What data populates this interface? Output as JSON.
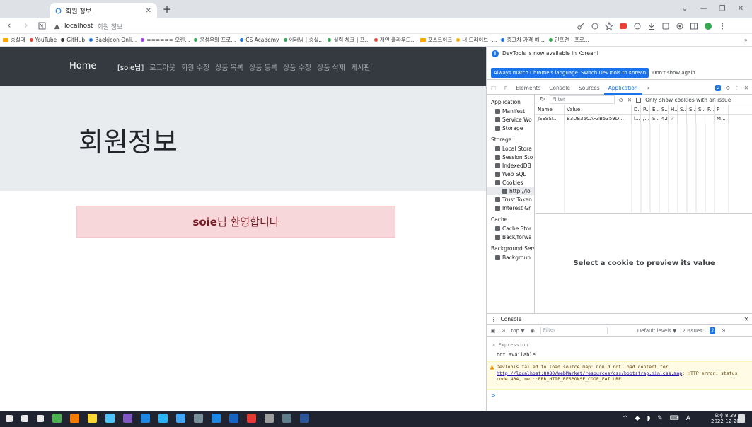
{
  "browser": {
    "tab_title": "회원 정보",
    "address_host": "localhost",
    "address_path": "회원 정보",
    "bookmarks": [
      {
        "label": "숭실대",
        "color": "#f9ab00",
        "folder": true
      },
      {
        "label": "YouTube",
        "color": "#ea4335"
      },
      {
        "label": "GitHub",
        "color": "#333333"
      },
      {
        "label": "Baekjoon Onli...",
        "color": "#1a73e8"
      },
      {
        "label": "====== 오렌...",
        "color": "#a142f4"
      },
      {
        "label": "윤성우의 프로...",
        "color": "#34a853"
      },
      {
        "label": "CS Academy",
        "color": "#1a73e8"
      },
      {
        "label": "이러닝 | 숭실...",
        "color": "#34a853"
      },
      {
        "label": "실력 체크 | 프...",
        "color": "#34a853"
      },
      {
        "label": "개인 클라우드...",
        "color": "#ea4335"
      },
      {
        "label": "포스트이크",
        "color": "#f9ab00",
        "folder": true
      },
      {
        "label": "내 드라이브 -...",
        "color": "#f9ab00"
      },
      {
        "label": "중고차 가격 예...",
        "color": "#1a73e8"
      },
      {
        "label": "인프런 - 프로...",
        "color": "#34a853"
      }
    ]
  },
  "page": {
    "nav_home": "Home",
    "nav_links": [
      "[soie님]",
      "로그아웃",
      "회원 수정",
      "상품 목록",
      "상품 등록",
      "상품 수정",
      "상품 삭제",
      "게시판"
    ],
    "jumbotron_title": "회원정보",
    "welcome_name": "soie",
    "welcome_suffix": "님 환영합니다"
  },
  "devtools": {
    "info_text": "DevTools is now available in Korean!",
    "btn_match": "Always match Chrome's language",
    "btn_switch": "Switch DevTools to Korean",
    "btn_dont_show": "Don't show again",
    "tabs": [
      "Elements",
      "Console",
      "Sources",
      "Application"
    ],
    "active_tab": "Application",
    "more_tabs": "»",
    "issues_count": "2",
    "sidebar": {
      "application_head": "Application",
      "application_items": [
        "Manifest",
        "Service Wo",
        "Storage"
      ],
      "storage_head": "Storage",
      "storage_items": [
        "Local Stora",
        "Session Sto",
        "IndexedDB",
        "Web SQL",
        "Cookies"
      ],
      "cookie_sub": "http://lo",
      "storage_items_2": [
        "Trust Token",
        "Interest Gr"
      ],
      "cache_head": "Cache",
      "cache_items": [
        "Cache Stor",
        "Back/forwa"
      ],
      "bg_head": "Background Servi",
      "bg_items": [
        "Backgroun"
      ]
    },
    "filter_placeholder": "Filter",
    "only_issue_label": "Only show cookies with an issue",
    "cookie_columns": [
      "Name",
      "Value",
      "D...",
      "P...",
      "E...",
      "S...",
      "H...",
      "S...",
      "S...",
      "S...",
      "P...",
      "P"
    ],
    "cookie_row": [
      "JSESSI...",
      "B3DE35CAF3B5359D...",
      "l...",
      "/...",
      "S...",
      "42",
      "✓",
      "",
      "",
      "",
      "",
      "M..."
    ],
    "preview_text": "Select a cookie to preview its value",
    "console_title": "Console",
    "console_context": "top ▼",
    "console_filter": "Filter",
    "default_levels": "Default levels ▼",
    "issues_label": "2 Issues:",
    "issues_badge": "2",
    "expression_label": "Expression",
    "expression_value": "not available",
    "warning_prefix": "DevTools failed to load source map: Could not load content for ",
    "warning_link": "http://localhost:8080/WebMarket/resources/css/bootstrap.min.css.map",
    "warning_suffix": ": HTTP error: status code 404, net::ERR_HTTP_RESPONSE_CODE_FAILURE",
    "prompt": ">"
  },
  "taskbar": {
    "time_line1": "오후 8:39",
    "time_line2": "2022-12-20",
    "ime": "A",
    "icon_colors": [
      "#ffffff",
      "#ffffff",
      "#ffffff",
      "#4caf50",
      "#f57c00",
      "#fdd835",
      "#4fc3f7",
      "#7e57c2",
      "#1e88e5",
      "#29b6f6",
      "#42a5f5",
      "#78909c",
      "#1e88e5",
      "#1565c0",
      "#e53935",
      "#9e9e9e",
      "#607d8b",
      "#2b579a"
    ]
  }
}
